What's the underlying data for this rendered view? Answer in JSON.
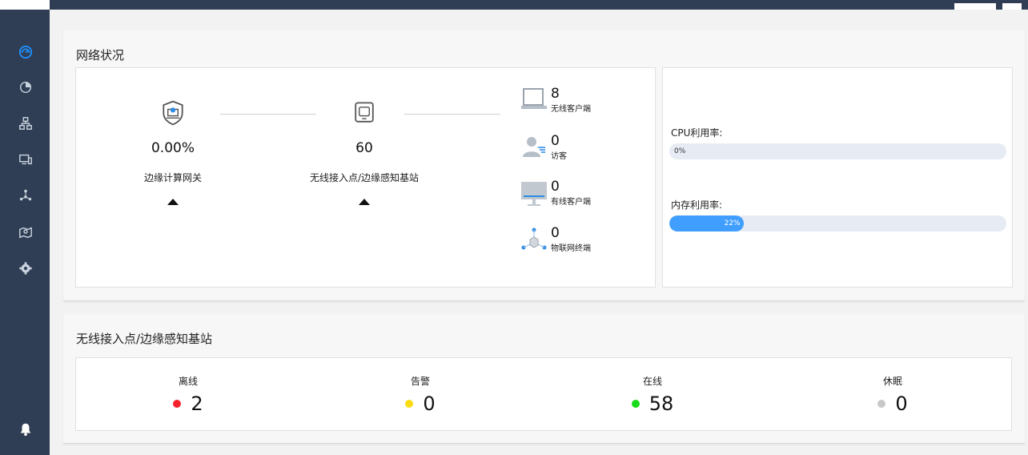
{
  "sidebar": {
    "items": [
      {
        "icon": "dashboard-icon"
      },
      {
        "icon": "pie-chart-icon"
      },
      {
        "icon": "topology-icon"
      },
      {
        "icon": "devices-icon"
      },
      {
        "icon": "iot-network-icon"
      },
      {
        "icon": "map-location-icon"
      },
      {
        "icon": "settings-gear-icon"
      },
      {
        "icon": "bell-icon"
      }
    ]
  },
  "network_status": {
    "title": "网络状况",
    "gateway": {
      "value": "0.00%",
      "label": "边缘计算网关"
    },
    "access_point": {
      "value": "60",
      "label": "无线接入点/边缘感知基站"
    },
    "clients": [
      {
        "count": "8",
        "label": "无线客户端",
        "icon": "laptop-icon"
      },
      {
        "count": "0",
        "label": "访客",
        "icon": "guest-user-icon"
      },
      {
        "count": "0",
        "label": "有线客户端",
        "icon": "desktop-monitor-icon"
      },
      {
        "count": "0",
        "label": "物联网终端",
        "icon": "iot-terminal-icon"
      }
    ],
    "cpu": {
      "label": "CPU利用率:",
      "percent": 0,
      "text": "0%"
    },
    "memory": {
      "label": "内存利用率:",
      "percent": 22,
      "text": "22%"
    }
  },
  "ap_status": {
    "title": "无线接入点/边缘感知基站",
    "items": [
      {
        "label": "离线",
        "value": "2",
        "color": "#f5222d"
      },
      {
        "label": "告警",
        "value": "0",
        "color": "#fadb14"
      },
      {
        "label": "在线",
        "value": "58",
        "color": "#1adb1a"
      },
      {
        "label": "休眠",
        "value": "0",
        "color": "#c8c8c8"
      }
    ]
  }
}
